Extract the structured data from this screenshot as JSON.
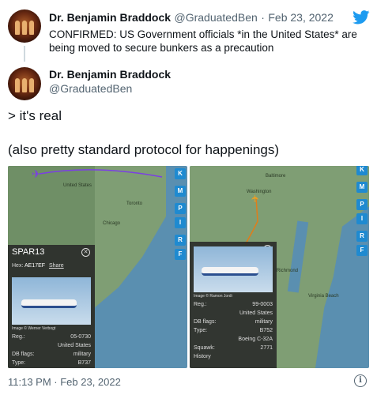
{
  "quoted_tweet": {
    "author_name": "Dr. Benjamin Braddock",
    "handle": "@GraduatedBen",
    "separator": "·",
    "date": "Feb 23, 2022",
    "text": "CONFIRMED: US Government officials *in the United States* are being moved to secure bunkers as a precaution"
  },
  "main_tweet": {
    "author_name": "Dr. Benjamin Braddock",
    "handle": "@GraduatedBen",
    "line1": "> it's real",
    "line2": "(also pretty standard protocol for happenings)",
    "timestamp": "11:13 PM · Feb 23, 2022"
  },
  "brand": {
    "icon": "twitter-bird-icon",
    "color": "#1d9bf0"
  },
  "map_buttons": [
    "K",
    "M",
    "P",
    "I",
    "R",
    "F"
  ],
  "left_map": {
    "labels": [
      "United States",
      "Chicago",
      "Toronto"
    ],
    "panel": {
      "callsign": "SPAR13",
      "hex_label": "Hex:",
      "hex": "AE17EF",
      "share": "Share",
      "image_credit": "Image © Werner Verbogt",
      "rows": [
        {
          "k": "Reg.:",
          "v": "05-0730"
        },
        {
          "k": "",
          "v": "United States"
        },
        {
          "k": "DB flags:",
          "v": "military"
        },
        {
          "k": "Type:",
          "v": "B737"
        }
      ]
    }
  },
  "right_map": {
    "labels": [
      "Baltimore",
      "Washington",
      "Virginia Beach",
      "Richmond"
    ],
    "panel": {
      "image_credit": "Image © Ramon Jordi",
      "rows": [
        {
          "k": "Reg.:",
          "v": "99-0003"
        },
        {
          "k": "",
          "v": "United States"
        },
        {
          "k": "DB flags:",
          "v": "military"
        },
        {
          "k": "Type:",
          "v": "B752"
        },
        {
          "k": "",
          "v": "Boeing C-32A"
        },
        {
          "k": "Squawk:",
          "v": "2771"
        },
        {
          "k": "History",
          "v": ""
        }
      ]
    }
  },
  "info_icon": "info-icon"
}
